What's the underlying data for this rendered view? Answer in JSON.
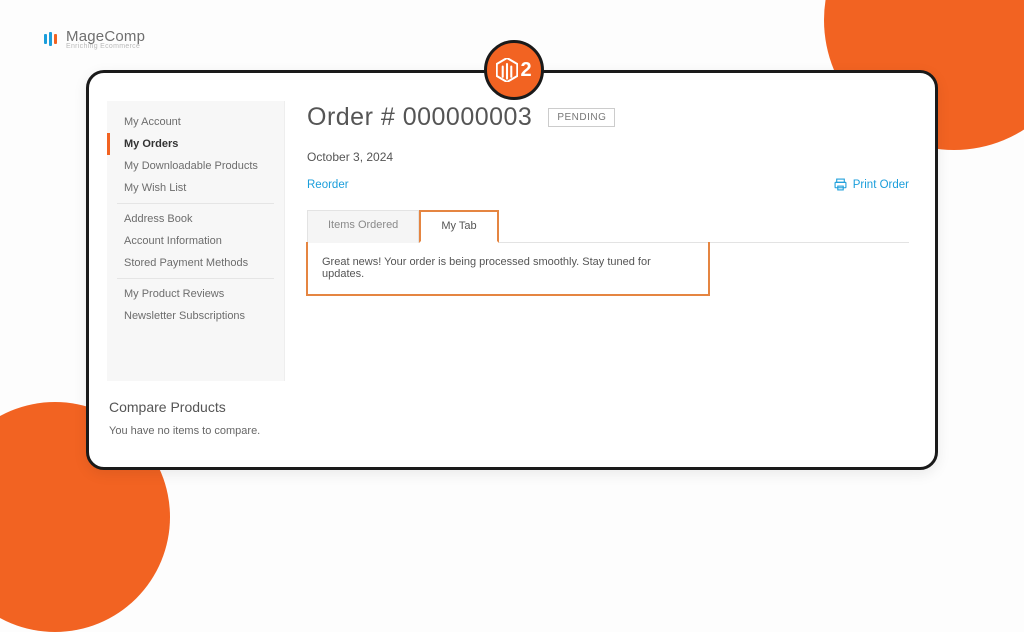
{
  "brand": {
    "name": "MageComp",
    "tagline": "Enriching Ecommerce"
  },
  "badge": {
    "number": "2"
  },
  "sidebar": {
    "active_index": 1,
    "groups": [
      {
        "items": [
          {
            "label": "My Account"
          },
          {
            "label": "My Orders"
          },
          {
            "label": "My Downloadable Products"
          },
          {
            "label": "My Wish List"
          }
        ]
      },
      {
        "items": [
          {
            "label": "Address Book"
          },
          {
            "label": "Account Information"
          },
          {
            "label": "Stored Payment Methods"
          }
        ]
      },
      {
        "items": [
          {
            "label": "My Product Reviews"
          },
          {
            "label": "Newsletter Subscriptions"
          }
        ]
      }
    ]
  },
  "order": {
    "title": "Order # 000000003",
    "status": "PENDING",
    "date": "October 3, 2024",
    "reorder_label": "Reorder",
    "print_label": "Print Order"
  },
  "tabs": {
    "active_index": 1,
    "items": [
      {
        "label": "Items Ordered"
      },
      {
        "label": "My Tab"
      }
    ],
    "panel_text": "Great news! Your order is being processed smoothly. Stay tuned for updates."
  },
  "compare": {
    "heading": "Compare Products",
    "empty": "You have no items to compare."
  }
}
